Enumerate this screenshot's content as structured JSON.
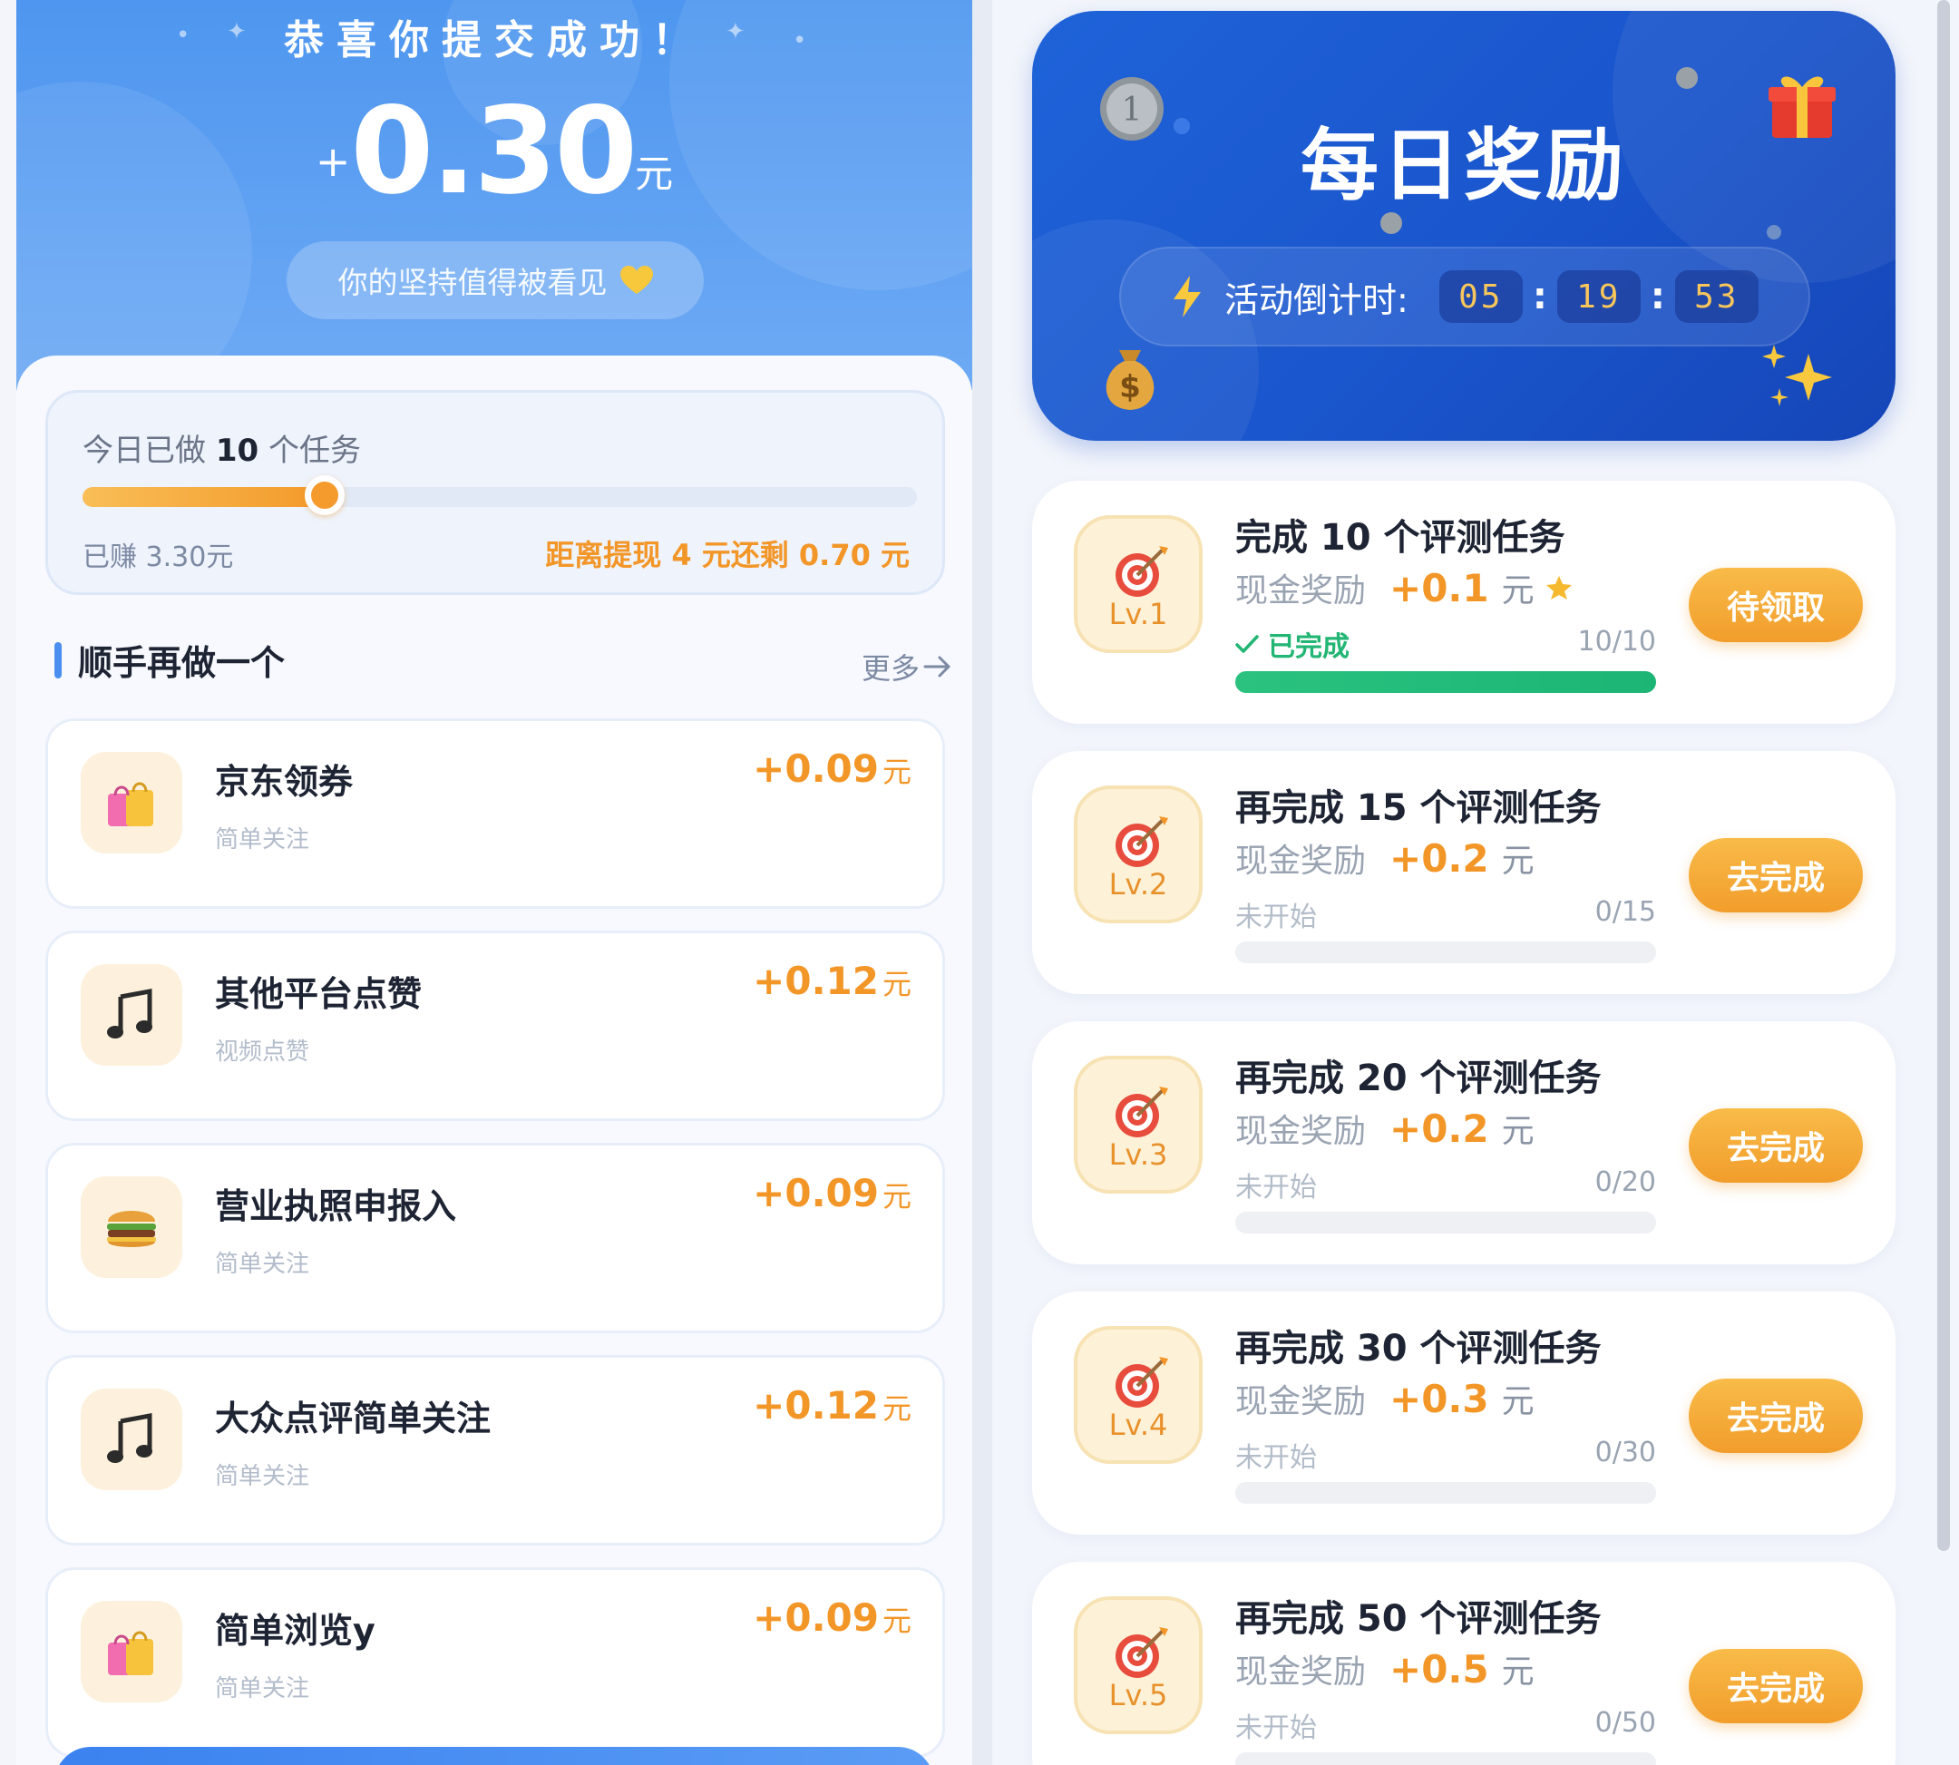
{
  "left": {
    "hero": {
      "title": "恭喜你提交成功！",
      "amount_plus": "+",
      "amount": "0.30",
      "amount_unit": "元",
      "encourage": "你的坚持值得被看见"
    },
    "progress": {
      "title_prefix": "今日已做",
      "title_count": "10",
      "title_suffix": "个任务",
      "fraction": 0.29,
      "earned": "已赚 3.30元",
      "remaining": "距离提现 4 元还剩 0.70 元"
    },
    "section": {
      "title": "顺手再做一个",
      "more": "更多"
    },
    "tasks": [
      {
        "name": "京东领券",
        "sub": "简单关注",
        "price": "+0.09",
        "unit": "元",
        "icon": "shopping-bags-icon"
      },
      {
        "name": "其他平台点赞",
        "sub": "视频点赞",
        "price": "+0.12",
        "unit": "元",
        "icon": "music-note-icon"
      },
      {
        "name": "营业执照申报入",
        "sub": "简单关注",
        "price": "+0.09",
        "unit": "元",
        "icon": "burger-icon"
      },
      {
        "name": "大众点评简单关注",
        "sub": "简单关注",
        "price": "+0.12",
        "unit": "元",
        "icon": "music-note-icon"
      },
      {
        "name": "简单浏览y",
        "sub": "简单关注",
        "price": "+0.09",
        "unit": "元",
        "icon": "shopping-bags-icon"
      }
    ]
  },
  "right": {
    "banner": {
      "title": "每日奖励",
      "countdown_label": "活动倒计时:",
      "hours": "05",
      "minutes": "19",
      "seconds": "53",
      "colon": ":"
    },
    "levels": [
      {
        "badge": "Lv.1",
        "name": "完成 10 个评测任务",
        "reward_label": "现金奖励",
        "amount": "+0.1",
        "unit": "元",
        "status": "已完成",
        "count": "10/10",
        "progress": 1.0,
        "button": "待领取",
        "done": true
      },
      {
        "badge": "Lv.2",
        "name": "再完成 15 个评测任务",
        "reward_label": "现金奖励",
        "amount": "+0.2",
        "unit": "元",
        "status": "未开始",
        "count": "0/15",
        "progress": 0,
        "button": "去完成",
        "done": false
      },
      {
        "badge": "Lv.3",
        "name": "再完成 20 个评测任务",
        "reward_label": "现金奖励",
        "amount": "+0.2",
        "unit": "元",
        "status": "未开始",
        "count": "0/20",
        "progress": 0,
        "button": "去完成",
        "done": false
      },
      {
        "badge": "Lv.4",
        "name": "再完成 30 个评测任务",
        "reward_label": "现金奖励",
        "amount": "+0.3",
        "unit": "元",
        "status": "未开始",
        "count": "0/30",
        "progress": 0,
        "button": "去完成",
        "done": false
      },
      {
        "badge": "Lv.5",
        "name": "再完成 50 个评测任务",
        "reward_label": "现金奖励",
        "amount": "+0.5",
        "unit": "元",
        "status": "未开始",
        "count": "0/50",
        "progress": 0,
        "button": "去完成",
        "done": false
      }
    ]
  },
  "colors": {
    "hero_blue": "#4e96ef",
    "accent_orange": "#f39628",
    "banner_blue": "#1f63d9",
    "done_green": "#22b573"
  }
}
